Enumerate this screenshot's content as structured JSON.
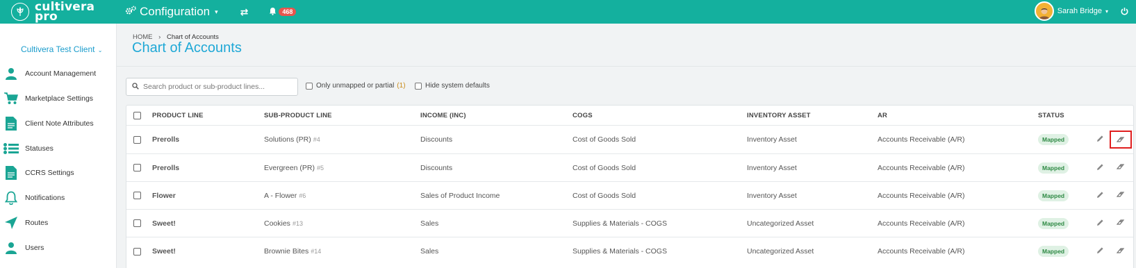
{
  "brand": {
    "line1": "cultivera",
    "line2": "pro"
  },
  "topbar": {
    "module": "Configuration",
    "notifications_count": "468",
    "user_name": "Sarah Bridge"
  },
  "sidebar": {
    "client": "Cultivera Test Client",
    "items": [
      {
        "label": "Account Management",
        "icon": "user-icon"
      },
      {
        "label": "Marketplace Settings",
        "icon": "cart-icon"
      },
      {
        "label": "Client Note Attributes",
        "icon": "document-icon"
      },
      {
        "label": "Statuses",
        "icon": "list-icon"
      },
      {
        "label": "CCRS Settings",
        "icon": "document-icon"
      },
      {
        "label": "Notifications",
        "icon": "bell-icon"
      },
      {
        "label": "Routes",
        "icon": "navigation-arrow-icon"
      },
      {
        "label": "Users",
        "icon": "user-icon"
      }
    ]
  },
  "breadcrumb": {
    "home": "HOME",
    "current": "Chart of Accounts"
  },
  "page_title": "Chart of Accounts",
  "search": {
    "placeholder": "Search product or sub-product lines...",
    "value": ""
  },
  "filters": {
    "only_unmapped_label": "Only unmapped or partial",
    "only_unmapped_count": "(1)",
    "hide_defaults_label": "Hide system defaults"
  },
  "table": {
    "columns": [
      "PRODUCT LINE",
      "SUB-PRODUCT LINE",
      "INCOME (INC)",
      "COGS",
      "INVENTORY ASSET",
      "AR",
      "STATUS"
    ],
    "rows": [
      {
        "product_line": "Prerolls",
        "sub_product_line": "Solutions (PR)",
        "sub_id": "#4",
        "income": "Discounts",
        "cogs": "Cost of Goods Sold",
        "inventory_asset": "Inventory Asset",
        "ar": "Accounts Receivable (A/R)",
        "status": "Mapped"
      },
      {
        "product_line": "Prerolls",
        "sub_product_line": "Evergreen (PR)",
        "sub_id": "#5",
        "income": "Discounts",
        "cogs": "Cost of Goods Sold",
        "inventory_asset": "Inventory Asset",
        "ar": "Accounts Receivable (A/R)",
        "status": "Mapped"
      },
      {
        "product_line": "Flower",
        "sub_product_line": "A - Flower",
        "sub_id": "#6",
        "income": "Sales of Product Income",
        "cogs": "Cost of Goods Sold",
        "inventory_asset": "Inventory Asset",
        "ar": "Accounts Receivable (A/R)",
        "status": "Mapped"
      },
      {
        "product_line": "Sweet!",
        "sub_product_line": "Cookies",
        "sub_id": "#13",
        "income": "Sales",
        "cogs": "Supplies & Materials - COGS",
        "inventory_asset": "Uncategorized Asset",
        "ar": "Accounts Receivable (A/R)",
        "status": "Mapped"
      },
      {
        "product_line": "Sweet!",
        "sub_product_line": "Brownie Bites",
        "sub_id": "#14",
        "income": "Sales",
        "cogs": "Supplies & Materials - COGS",
        "inventory_asset": "Uncategorized Asset",
        "ar": "Accounts Receivable (A/R)",
        "status": "Mapped"
      }
    ]
  },
  "colors": {
    "topbar": "#14b09e",
    "link": "#1fa8d6",
    "mapped_bg": "#dff1e4",
    "mapped_text": "#2f8a45",
    "badge": "#e8554e",
    "highlight": "#e01e1e"
  }
}
